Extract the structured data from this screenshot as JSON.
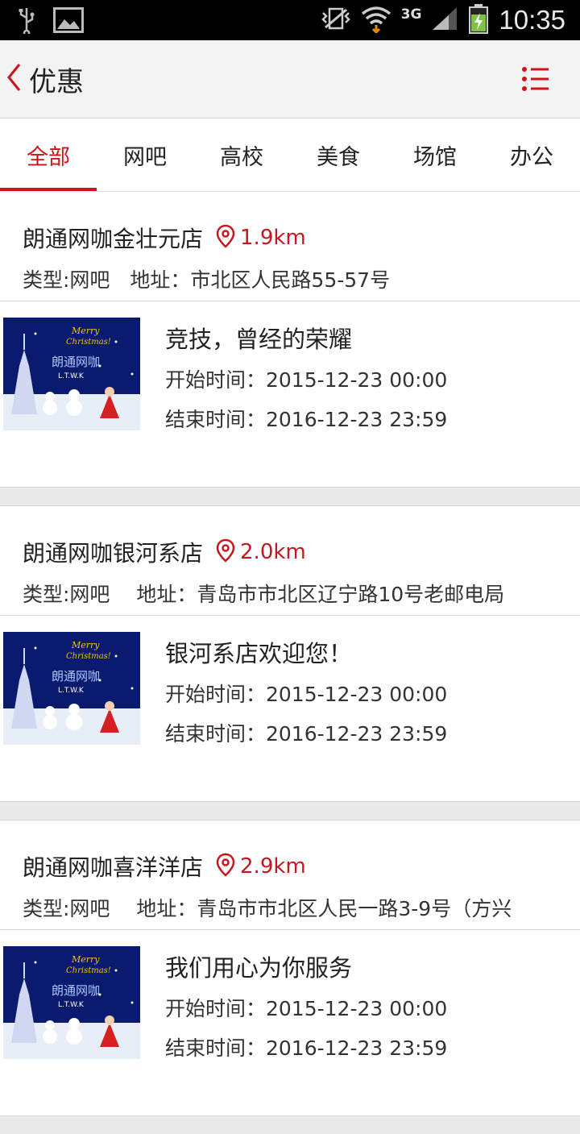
{
  "status_bar": {
    "time": "10:35",
    "network": "3G"
  },
  "header": {
    "title": "优惠"
  },
  "tabs": [
    {
      "label": "全部",
      "active": true
    },
    {
      "label": "网吧",
      "active": false
    },
    {
      "label": "高校",
      "active": false
    },
    {
      "label": "美食",
      "active": false
    },
    {
      "label": "场馆",
      "active": false
    },
    {
      "label": "办公",
      "active": false
    }
  ],
  "cards": [
    {
      "store_name": "朗通网咖金壮元店",
      "distance": "1.9km",
      "meta": "类型:网吧　地址：市北区人民路55-57号",
      "promo_title": "竞技，曾经的荣耀",
      "start": "开始时间：2015-12-23 00:00",
      "end": "结束时间：2016-12-23 23:59"
    },
    {
      "store_name": "朗通网咖银河系店",
      "distance": "2.0km",
      "meta": "类型:网吧　 地址：青岛市市北区辽宁路10号老邮电局",
      "promo_title": "银河系店欢迎您！",
      "start": "开始时间：2015-12-23 00:00",
      "end": "结束时间：2016-12-23 23:59"
    },
    {
      "store_name": "朗通网咖喜洋洋店",
      "distance": "2.9km",
      "meta": "类型:网吧　 地址：青岛市市北区人民一路3-9号（方兴",
      "promo_title": "我们用心为你服务",
      "start": "开始时间：2015-12-23 00:00",
      "end": "结束时间：2016-12-23 23:59"
    }
  ],
  "thumbnail": {
    "line1": "Merry",
    "line2": "Christmas!",
    "line3": "朗通网咖",
    "line4": "L.T.W.K"
  },
  "colors": {
    "accent": "#d0121b",
    "header_bg": "#f3f3f3",
    "divider_bg": "#e9e9e9"
  }
}
